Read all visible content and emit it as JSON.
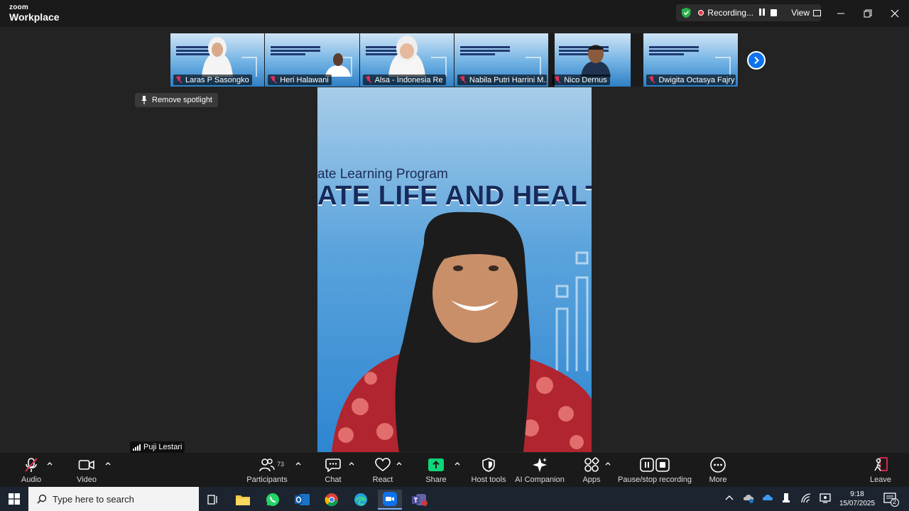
{
  "titlebar": {
    "logo_small": "zoom",
    "logo_big": "Workplace",
    "recording_label": "Recording...",
    "view_label": "View"
  },
  "thumbnails": [
    {
      "name": "Laras P Sasongko"
    },
    {
      "name": "Heri Halawani"
    },
    {
      "name": "Alsa - Indonesia Re"
    },
    {
      "name": "Nabila Putri Harrini M..."
    },
    {
      "name": "Nico Dernus"
    },
    {
      "name": "Dwigita Octasya Fajry"
    }
  ],
  "spotlight_label": "Remove spotlight",
  "main_video": {
    "banner_subtitle": "ate Learning Program",
    "banner_title": "ATE LIFE AND HEALT",
    "speaker_name": "Puji Lestari"
  },
  "toolbar": {
    "audio": "Audio",
    "video": "Video",
    "participants": "Participants",
    "participants_count": "73",
    "chat": "Chat",
    "react": "React",
    "share": "Share",
    "host_tools": "Host tools",
    "ai_companion": "AI Companion",
    "apps": "Apps",
    "pause_stop": "Pause/stop recording",
    "more": "More",
    "leave": "Leave"
  },
  "taskbar": {
    "search_placeholder": "Type here to search",
    "time": "9:18",
    "date": "15/07/2025",
    "notification_count": "2"
  },
  "colors": {
    "accent_blue": "#0e72ed",
    "share_green": "#0ed67a",
    "record_red": "#e63946",
    "leave_red": "#e02f5a"
  }
}
